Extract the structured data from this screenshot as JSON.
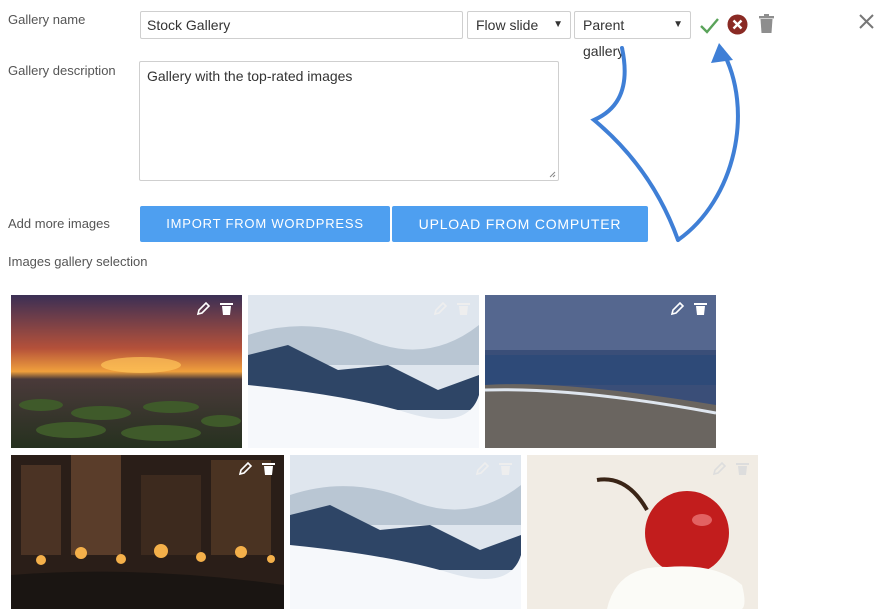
{
  "form": {
    "gallery_name_label": "Gallery name",
    "gallery_name_value": "Stock Gallery",
    "layout_select": "Flow slide",
    "parent_select": "Parent gallery",
    "description_label": "Gallery description",
    "description_value": "Gallery with the top-rated images",
    "add_images_label": "Add more images",
    "import_button": "IMPORT FROM WORDPRESS",
    "upload_button": "UPLOAD FROM COMPUTER",
    "selection_label": "Images gallery selection"
  },
  "actions": {
    "confirm_icon": "check-icon",
    "cancel_icon": "cancel-circle-icon",
    "delete_icon": "trash-icon",
    "close_icon": "close-icon"
  },
  "colors": {
    "accent": "#4e9ff0",
    "confirm": "#5aa35a",
    "cancel": "#8a2a24",
    "muted_icon": "#8e8e8e",
    "annotation_arrow": "#3f7fd6"
  },
  "gallery": {
    "images": [
      {
        "subject": "sunset over tidal flats",
        "icons": [
          "edit-icon",
          "trash-icon"
        ]
      },
      {
        "subject": "snowy mountain slope",
        "icons": [
          "edit-icon",
          "trash-icon"
        ]
      },
      {
        "subject": "stormy sea shore",
        "icons": [
          "edit-icon",
          "trash-icon"
        ]
      },
      {
        "subject": "city lights at night",
        "icons": [
          "edit-icon",
          "trash-icon"
        ]
      },
      {
        "subject": "snowy mountain slope",
        "icons": [
          "edit-icon",
          "trash-icon"
        ]
      },
      {
        "subject": "cherry on cream",
        "icons": [
          "edit-icon",
          "trash-icon"
        ]
      }
    ]
  }
}
